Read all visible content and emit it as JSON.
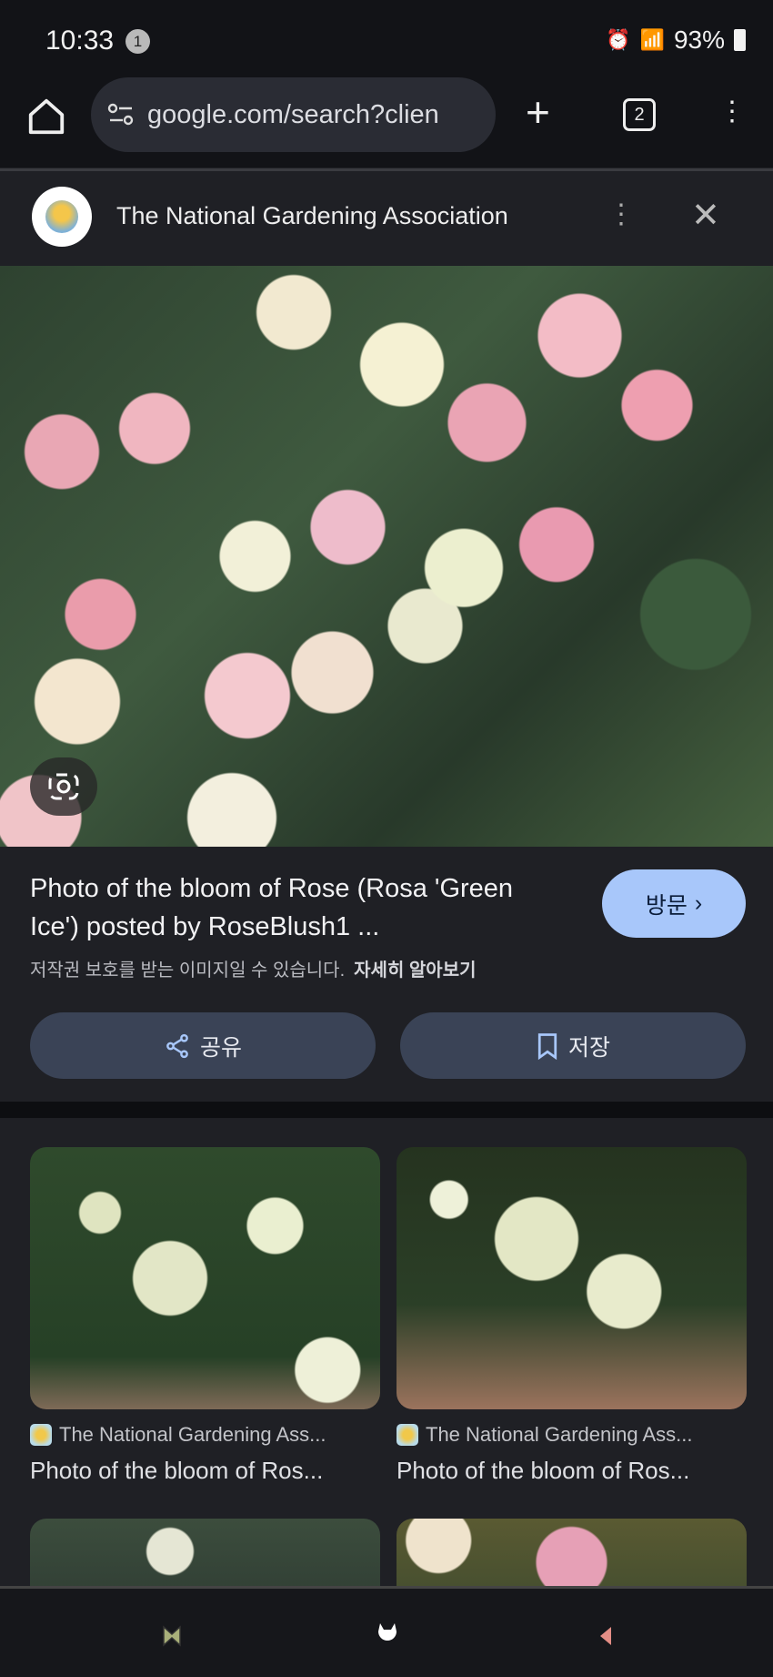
{
  "status_bar": {
    "time": "10:33",
    "notification_count": "1",
    "battery": "93%",
    "icons": [
      "battery-saver-icon",
      "alarm-icon",
      "wifi-icon",
      "hd-voice-icon",
      "signal-icon",
      "battery-icon"
    ]
  },
  "toolbar": {
    "url": "google.com/search?clien",
    "tab_count": "2"
  },
  "header": {
    "site_name": "The National Gardening Association"
  },
  "detail": {
    "title": "Photo of the bloom of Rose (Rosa 'Green Ice') posted by RoseBlush1 ...",
    "visit_label": "방문",
    "copyright": "저작권 보호를 받는 이미지일 수 있습니다.",
    "learn_more": "자세히 알아보기",
    "share_label": "공유",
    "save_label": "저장"
  },
  "related": [
    {
      "source": "The National Gardening Ass...",
      "title": "Photo of the bloom of Ros..."
    },
    {
      "source": "The National Gardening Ass...",
      "title": "Photo of the bloom of Ros..."
    }
  ],
  "colors": {
    "accent": "#a8c7fa",
    "button_bg": "#3a4356",
    "panel_bg": "#1f2025"
  }
}
